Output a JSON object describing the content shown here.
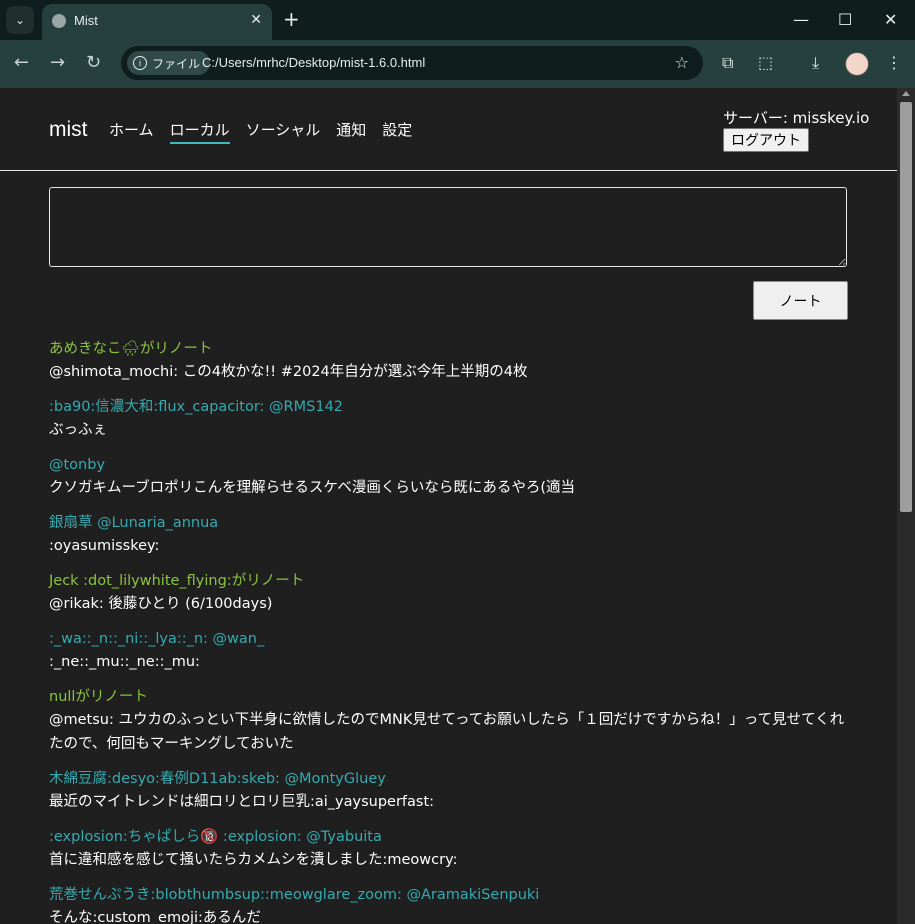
{
  "browser": {
    "tab_title": "Mist",
    "file_label": "ファイル",
    "url": "C:/Users/mrhc/Desktop/mist-1.6.0.html"
  },
  "app": {
    "logo": "mist",
    "nav": [
      "ホーム",
      "ローカル",
      "ソーシャル",
      "通知",
      "設定"
    ],
    "active_nav": "ローカル",
    "server": "サーバー: misskey.io",
    "logout": "ログアウト",
    "compose_placeholder": "",
    "note_button": "ノート"
  },
  "notes": [
    {
      "kind": "renote",
      "head": "あめきなこ🌧がリノート",
      "body": "@shimota_mochi: この4枚かな!! #2024年自分が選ぶ今年上半期の4枚"
    },
    {
      "kind": "user",
      "head": ":ba90:信濃大和:flux_capacitor: @RMS142",
      "body": "ぶっふぇ"
    },
    {
      "kind": "user",
      "head": "@tonby",
      "body": "クソガキムーブロポリこんを理解らせるスケベ漫画くらいなら既にあるやろ(適当"
    },
    {
      "kind": "user",
      "head": "銀扇草 @Lunaria_annua",
      "body": ":oyasumisskey:"
    },
    {
      "kind": "renote",
      "head": "Jeck :dot_lilywhite_flying:がリノート",
      "body": "@rikak: 後藤ひとり (6/100days)"
    },
    {
      "kind": "user",
      "head": ":_wa::_n::_ni::_lya::_n: @wan_",
      "body": ":_ne::_mu::_ne::_mu:"
    },
    {
      "kind": "renote",
      "head": "nullがリノート",
      "body": "@metsu: ユウカのふっとい下半身に欲情したのでMNK見せてってお願いしたら「１回だけですからね！」って見せてくれたので、何回もマーキングしておいた"
    },
    {
      "kind": "user",
      "head": "木綿豆腐:desyo:春例D11ab:skeb: @MontyGluey",
      "body": "最近のマイトレンドは細ロリとロリ巨乳:ai_yaysuperfast:"
    },
    {
      "kind": "user",
      "head": ":explosion:ちゃぱしら🔞 :explosion: @Tyabuita",
      "body": "首に違和感を感じて掻いたらカメムシを潰しました:meowcry:"
    },
    {
      "kind": "user",
      "head": "荒巻せんぷうき:blobthumbsup::meowglare_zoom: @AramakiSenpuki",
      "body": "そんな:custom_emoji:あるんだ"
    }
  ]
}
